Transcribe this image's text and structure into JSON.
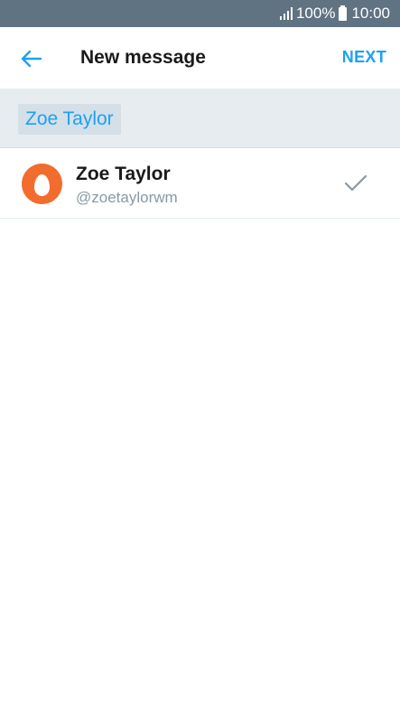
{
  "status_bar": {
    "battery_text": "100%",
    "time": "10:00",
    "icons": [
      "signal-icon",
      "battery-icon"
    ]
  },
  "app_bar": {
    "back_icon": "back-arrow-icon",
    "title": "New message",
    "next_label": "NEXT",
    "accent_color": "#1da1f2"
  },
  "recipients": {
    "selected": [
      {
        "label": "Zoe Taylor"
      }
    ]
  },
  "results": [
    {
      "name": "Zoe Taylor",
      "handle": "@zoetaylorwm",
      "avatar": "egg-avatar",
      "avatar_color": "#f26c2d",
      "selected": true,
      "selected_icon": "check-icon"
    }
  ]
}
